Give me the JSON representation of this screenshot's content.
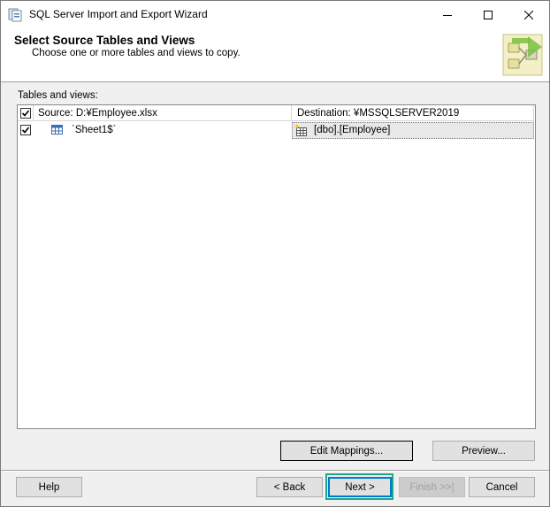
{
  "window": {
    "title": "SQL Server Import and Export Wizard",
    "icon": "wizard-app-icon",
    "controls": [
      "minimize-icon",
      "maximize-icon",
      "close-icon"
    ]
  },
  "header": {
    "title": "Select Source Tables and Views",
    "subtitle": "Choose one or more tables and views to copy."
  },
  "tables": {
    "group_label": "Tables and views:",
    "columns": {
      "source": "Source: D:¥Employee.xlsx",
      "destination": "Destination: ¥MSSQLSERVER2019"
    },
    "header_checked": true,
    "rows": [
      {
        "checked": true,
        "source": "`Sheet1$`",
        "destination": "[dbo].[Employee]"
      }
    ]
  },
  "actions": {
    "edit_mappings": "Edit Mappings...",
    "preview": "Preview..."
  },
  "footer": {
    "help": "Help",
    "back": "< Back",
    "next": "Next >",
    "finish": "Finish >>|",
    "cancel": "Cancel"
  },
  "colors": {
    "highlight": "#1aaa8a",
    "selection_bg": "#e8e8e8"
  }
}
